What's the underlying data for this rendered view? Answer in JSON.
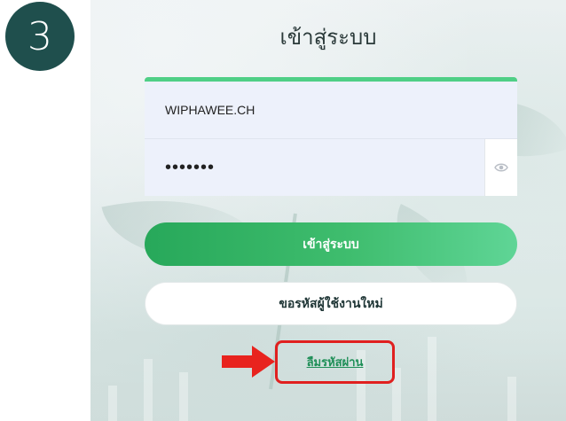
{
  "step": {
    "number": "3"
  },
  "login": {
    "title": "เข้าสู่ระบบ",
    "username_value": "WIPHAWEE.CH",
    "password_value": "•••••••",
    "login_button": "เข้าสู่ระบบ",
    "register_button": "ขอรหัสผู้ใช้งานใหม่",
    "forgot_password_link": "ลืมรหัสผ่าน"
  },
  "icons": {
    "password_toggle": "eye-icon",
    "pointer": "red-arrow-icon"
  },
  "colors": {
    "badge": "#1f4f4d",
    "accent_green": "#3fbd6e",
    "link_green": "#1f8f58",
    "highlight_red": "#e0201f"
  }
}
